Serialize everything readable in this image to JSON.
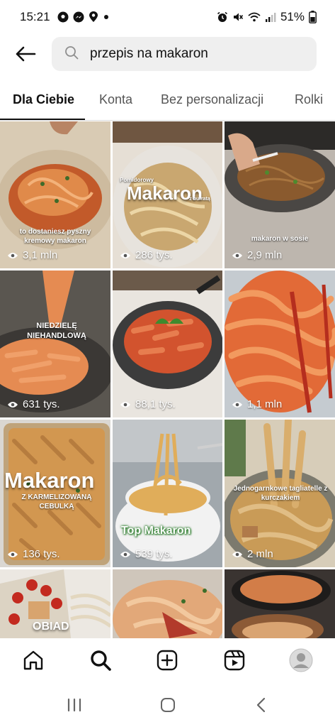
{
  "status_bar": {
    "time": "15:21",
    "battery": "51%",
    "left_icons": [
      "soccer-ball-icon",
      "messenger-icon",
      "location-pin-icon",
      "dot-icon"
    ],
    "right_icons": [
      "alarm-icon",
      "mute-icon",
      "wifi-icon",
      "signal-icon",
      "battery-icon"
    ]
  },
  "search": {
    "query": "przepis na makaron"
  },
  "tabs": [
    {
      "label": "Dla Ciebie",
      "active": true
    },
    {
      "label": "Konta",
      "active": false
    },
    {
      "label": "Bez personalizacji",
      "active": false
    },
    {
      "label": "Rolki",
      "active": false
    }
  ],
  "grid": [
    {
      "views": "3,1 mln",
      "overlay": "to dostaniesz pyszny kremowy makaron",
      "colors": [
        "#d9cbb4",
        "#c25a2a",
        "#e08a4a"
      ]
    },
    {
      "views": "286 tys.",
      "overlay_big": "Makaron",
      "overlay_top": "Pomidorowy",
      "overlay_bottom": "z burratą",
      "colors": [
        "#e6dfd5",
        "#c9a770",
        "#ecd6a6"
      ]
    },
    {
      "views": "2,9 mln",
      "overlay": "makaron w sosie",
      "colors": [
        "#bdb6ae",
        "#4a4744",
        "#8a5a2e"
      ]
    },
    {
      "views": "631 tys.",
      "overlay": "NIEDZIELĘ NIEHANDLOWĄ",
      "colors": [
        "#5a5650",
        "#e58b52",
        "#f0a06a"
      ]
    },
    {
      "views": "88,1 tys.",
      "colors": [
        "#e9e5df",
        "#3c3c3c",
        "#d2532e"
      ]
    },
    {
      "views": "1,1 mln",
      "colors": [
        "#c5cbd0",
        "#e26a37",
        "#f29a5f"
      ]
    },
    {
      "views": "136 tys.",
      "overlay_big": "Makaron",
      "overlay_bottom": "Z KARMELIZOWANĄ CEBULKĄ",
      "colors": [
        "#dad7d2",
        "#d29750",
        "#b67c3e"
      ]
    },
    {
      "views": "539 tys.",
      "overlay_big": "Top Makaron",
      "colors": [
        "#a1a8ad",
        "#f2f2f2",
        "#e0ad5a"
      ]
    },
    {
      "views": "2 mln",
      "overlay": "Jednogarnkowe tagliatelle z kurczakiem",
      "colors": [
        "#d7cdb9",
        "#c99b57",
        "#7c7a6e"
      ]
    },
    {
      "views": "",
      "overlay_big": "OBIAD",
      "colors": [
        "#ece8e2",
        "#e3d7bf",
        "#c32a1f"
      ]
    },
    {
      "views": "",
      "colors": [
        "#cfc6bb",
        "#e2a879",
        "#b23a2b"
      ]
    },
    {
      "views": "",
      "colors": [
        "#3a3431",
        "#d27d48",
        "#8c5a36"
      ]
    }
  ],
  "bottom_nav": [
    "home-icon",
    "search-icon",
    "create-icon",
    "reels-icon",
    "profile-avatar"
  ],
  "system_nav": [
    "recents-icon",
    "home-circle-icon",
    "back-chevron-icon"
  ]
}
